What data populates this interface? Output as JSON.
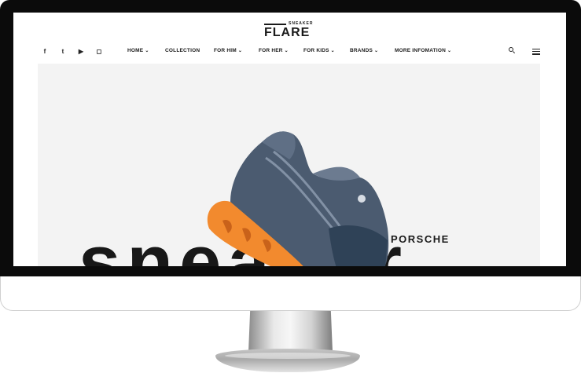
{
  "header": {
    "logo_word": "FLARE",
    "logo_tag": "SNEAKER"
  },
  "social": [
    {
      "icon": "facebook-icon",
      "glyph": "f"
    },
    {
      "icon": "twitter-icon",
      "glyph": "t"
    },
    {
      "icon": "youtube-icon",
      "glyph": "▶"
    },
    {
      "icon": "instagram-icon",
      "glyph": "◻"
    }
  ],
  "nav": {
    "items": [
      {
        "label": "HOME",
        "has_dropdown": true
      },
      {
        "label": "COLLECTION",
        "has_dropdown": false
      },
      {
        "label": "FOR HIM",
        "has_dropdown": true
      },
      {
        "label": "FOR HER",
        "has_dropdown": true
      },
      {
        "label": "FOR KIDS",
        "has_dropdown": true
      },
      {
        "label": "BRANDS",
        "has_dropdown": true
      },
      {
        "label": "MORE INFOMATION",
        "has_dropdown": true
      }
    ],
    "chevron": "⌄"
  },
  "hero": {
    "big_word": "sneaker",
    "brand": "PORSCHE"
  },
  "colors": {
    "accent": "#f28a2e",
    "shoe_body": "#4a5a6e",
    "hero_bg": "#f3f3f3"
  }
}
